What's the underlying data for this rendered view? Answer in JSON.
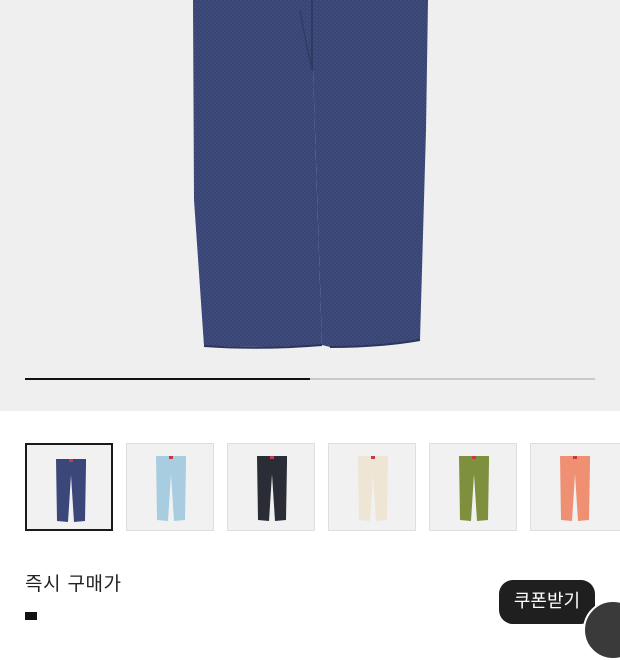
{
  "product": {
    "image_icon": "navy-pants-photo",
    "gallery_progress": 0.5,
    "colors": {
      "navy": "#3b4a7a",
      "background": "#efefef"
    }
  },
  "thumbnails": [
    {
      "icon": "navy-pants",
      "color": "#3a4778",
      "selected": true
    },
    {
      "icon": "light-blue-pants",
      "color": "#a9cde0",
      "selected": false
    },
    {
      "icon": "black-pants",
      "color": "#2a2d36",
      "selected": false
    },
    {
      "icon": "cream-pants",
      "color": "#eee5d5",
      "selected": false
    },
    {
      "icon": "olive-pants",
      "color": "#7e8f3e",
      "selected": false
    },
    {
      "icon": "salmon-pants",
      "color": "#ef9073",
      "selected": false
    }
  ],
  "purchase": {
    "instant_price_label": "즉시 구매가"
  },
  "coupon": {
    "label": "쿠폰받기"
  }
}
